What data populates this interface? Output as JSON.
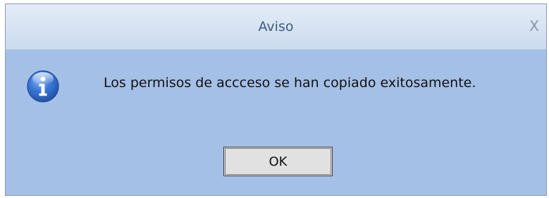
{
  "dialog": {
    "title": "Aviso",
    "close_label": "X",
    "message": "Los permisos de accceso se han copiado exitosamente.",
    "icon": "info-icon",
    "ok_label": "OK"
  },
  "colors": {
    "title_text": "#3e5a82",
    "body_background": "#a5c0e6",
    "icon_blue": "#2e6ad0"
  }
}
